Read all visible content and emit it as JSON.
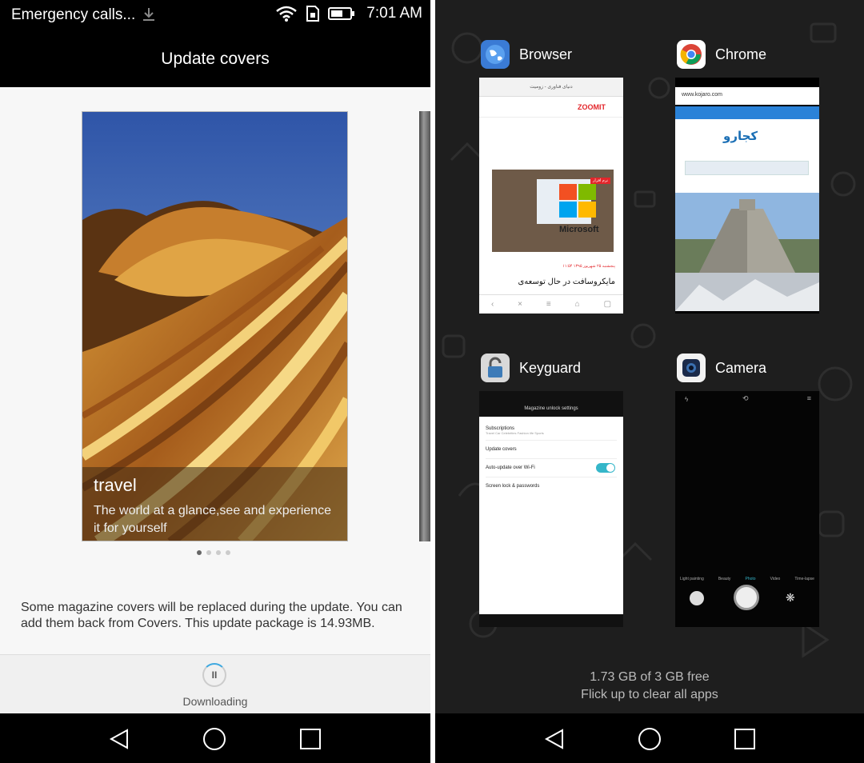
{
  "left": {
    "status": {
      "carrier": "Emergency calls...",
      "time": "7:01 AM"
    },
    "title": "Update covers",
    "cover": {
      "title": "travel",
      "description": "The world at a glance,see and experience it for yourself"
    },
    "page_dots": 4,
    "active_dot": 0,
    "note": "Some magazine covers will be replaced during the update. You can add them back from Covers. This update package is 14.93MB.",
    "download": {
      "label": "Downloading",
      "icon": "pause-icon"
    }
  },
  "right": {
    "apps": [
      {
        "name": "Browser",
        "icon": "browser-globe-icon",
        "thumb": {
          "brand": "ZOOMIT",
          "url": "دنیای فناوری - زومیت",
          "tag": "نرم افزار",
          "image_text": "Microsoft",
          "meta": "پنجشنبه ۲۵ شهریور ۱۳۹۵ ۱۱:۵۴",
          "headline": "مایکروسافت در حال توسعه‌ی"
        }
      },
      {
        "name": "Chrome",
        "icon": "chrome-icon",
        "thumb": {
          "url": "www.kojaro.com",
          "brand": "کجارو"
        }
      },
      {
        "name": "Keyguard",
        "icon": "keyguard-lock-icon",
        "thumb": {
          "header": "Magazine unlock settings",
          "items": [
            {
              "label": "Subscriptions",
              "sub": "Travel Car Celebrities Fashion life Sports"
            },
            {
              "label": "Update covers",
              "sub": ""
            },
            {
              "label": "Auto-update over Wi-Fi",
              "sub": ""
            },
            {
              "label": "Screen lock & passwords",
              "sub": ""
            }
          ],
          "toggle_on": true
        }
      },
      {
        "name": "Camera",
        "icon": "camera-icon",
        "thumb": {
          "modes": [
            "Light painting",
            "Beauty",
            "Photo",
            "Video",
            "Time-lapse"
          ],
          "active_mode": "Photo"
        }
      }
    ],
    "memory": "1.73 GB of 3 GB free",
    "hint": "Flick up to clear all apps"
  },
  "colors": {
    "accent": "#3fa9e0",
    "toggle": "#35b6c9",
    "zoomit_red": "#e3262b"
  }
}
